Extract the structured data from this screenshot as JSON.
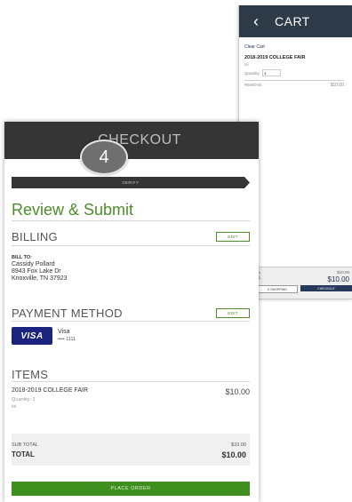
{
  "cart_screen": {
    "title": "CART",
    "back_icon": "chevron-left-icon",
    "clear_cart": "Clear Cart",
    "item_title": "2018-2019 COLLEGE FAIR",
    "item_sub": "ioi",
    "quantity_label": "Quantity:",
    "quantity_value": "1",
    "remove_label": "REMOVE",
    "item_price": "$10.00",
    "subtotal_label": "L",
    "subtotal_value": "$10.00",
    "total_label": "L",
    "total_value": "$10.00",
    "continue_label": "E SHOPPING",
    "checkout_label": "CHECKOUT"
  },
  "checkout": {
    "title": "CHECKOUT",
    "step_number": "4",
    "step_label": "VERIFY",
    "heading": "Review & Submit",
    "billing": {
      "title": "BILLING",
      "edit_label": "EDIT",
      "bill_to_label": "BILL TO:",
      "name": "Cassidy Pollard",
      "address_line1": "8943 Fox Lake Dr",
      "address_line2": "Knoxville, TN 37923"
    },
    "payment": {
      "title": "PAYMENT METHOD",
      "edit_label": "EDIT",
      "card_brand_logo": "VISA",
      "card_type": "Visa",
      "card_mask": "•••• 1111"
    },
    "items": {
      "title": "ITEMS",
      "list": [
        {
          "name": "2018-2019 COLLEGE FAIR",
          "price": "$10.00",
          "quantity": "Quantity: 1",
          "sub": "ioi"
        }
      ]
    },
    "totals": {
      "subtotal_label": "SUB TOTAL",
      "subtotal_value": "$10.00",
      "total_label": "TOTAL",
      "total_value": "$10.00"
    },
    "place_order_label": "PLACE ORDER"
  },
  "colors": {
    "header_dark": "#353535",
    "cart_header": "#2f3a49",
    "accent_green": "#4d8d2d",
    "button_green": "#3f8f1f",
    "visa_blue": "#1a237e",
    "checkout_button": "#26395c"
  }
}
